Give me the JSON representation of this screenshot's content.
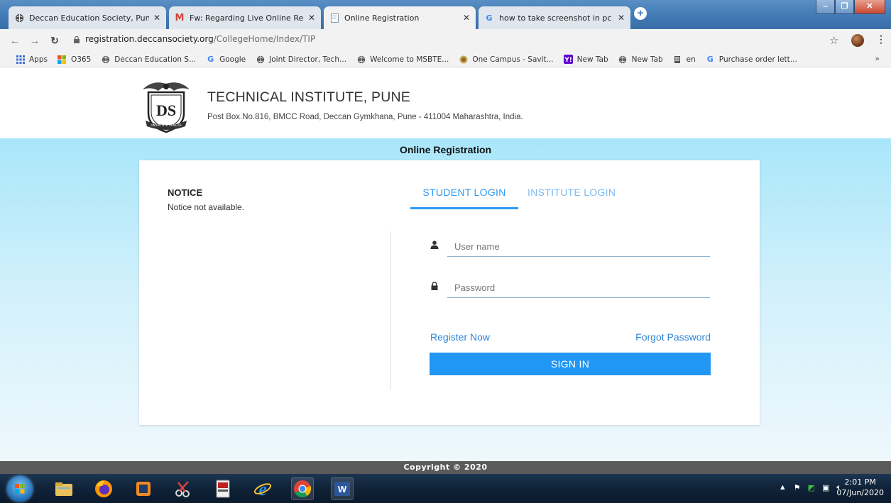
{
  "browser": {
    "tabs": [
      {
        "title": "Deccan Education Society, Pune.",
        "active": false
      },
      {
        "title": "Fw: Regarding Live Online Regist",
        "active": false
      },
      {
        "title": "Online Registration",
        "active": true
      },
      {
        "title": "how to take screenshot in pc - G",
        "active": false
      }
    ],
    "url_host": "registration.deccansociety.org",
    "url_path": "/CollegeHome/Index/TIP",
    "bookmarks": [
      "Apps",
      "O365",
      "Deccan Education S...",
      "Google",
      "Joint Director, Tech...",
      "Welcome to MSBTE...",
      "One Campus - Savit...",
      "New Tab",
      "New Tab",
      "en",
      "Purchase order lett..."
    ],
    "more_bookmarks": "»"
  },
  "header": {
    "institute_name": "TECHNICAL INSTITUTE, PUNE",
    "address": "Post Box.No.816, BMCC Road, Deccan Gymkhana, Pune - 411004 Maharashtra, India.",
    "logo_letters": "DS",
    "logo_motto": "UNION IS STRENGTH"
  },
  "main": {
    "heading": "Online Registration",
    "notice_title": "NOTICE",
    "notice_text": "Notice not available.",
    "tabs": {
      "student": "STUDENT LOGIN",
      "institute": "INSTITUTE LOGIN"
    },
    "username_placeholder": "User name",
    "password_placeholder": "Password",
    "register_label": "Register Now",
    "forgot_label": "Forgot Password",
    "signin_label": "SIGN IN"
  },
  "footer": {
    "copyright": "Copyright © 2020"
  },
  "taskbar": {
    "time": "2:01 PM",
    "date": "07/Jun/2020"
  },
  "colors": {
    "primary": "#2196f3",
    "link": "#2f85d8",
    "body_top": "#a9e6fa"
  }
}
